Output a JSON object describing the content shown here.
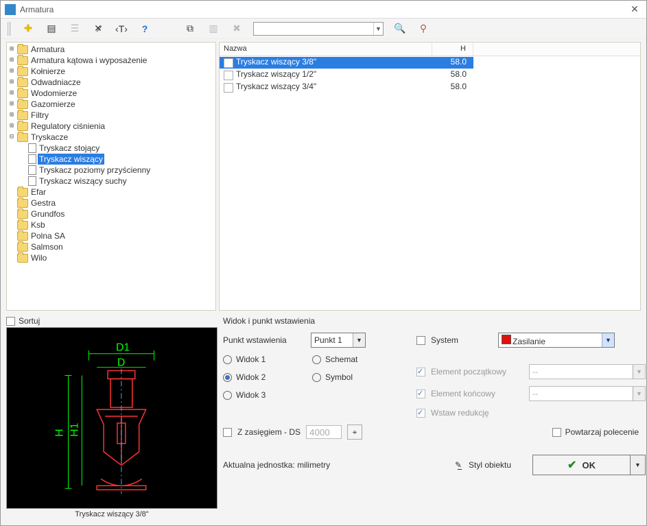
{
  "title": "Armatura",
  "toolbar": {
    "search_value": ""
  },
  "tree": [
    {
      "label": "Armatura",
      "type": "folder",
      "expandable": true
    },
    {
      "label": "Armatura kątowa i wyposażenie",
      "type": "folder",
      "expandable": true
    },
    {
      "label": "Kołnierze",
      "type": "folder",
      "expandable": true
    },
    {
      "label": "Odwadniacze",
      "type": "folder",
      "expandable": true
    },
    {
      "label": "Wodomierze",
      "type": "folder",
      "expandable": true
    },
    {
      "label": "Gazomierze",
      "type": "folder",
      "expandable": true
    },
    {
      "label": "Filtry",
      "type": "folder",
      "expandable": true
    },
    {
      "label": "Regulatory ciśnienia",
      "type": "folder",
      "expandable": true
    },
    {
      "label": "Tryskacze",
      "type": "folder",
      "expandable": true,
      "expanded": true,
      "children": [
        {
          "label": "Tryskacz stojący",
          "type": "doc"
        },
        {
          "label": "Tryskacz wiszący",
          "type": "doc",
          "selected": true
        },
        {
          "label": "Tryskacz poziomy przyścienny",
          "type": "doc"
        },
        {
          "label": "Tryskacz wiszący suchy",
          "type": "doc"
        }
      ]
    },
    {
      "label": "Efar",
      "type": "folder"
    },
    {
      "label": "Gestra",
      "type": "folder"
    },
    {
      "label": "Grundfos",
      "type": "folder"
    },
    {
      "label": "Ksb",
      "type": "folder"
    },
    {
      "label": "Polna SA",
      "type": "folder"
    },
    {
      "label": "Salmson",
      "type": "folder"
    },
    {
      "label": "Wilo",
      "type": "folder"
    }
  ],
  "list": {
    "col1": "Nazwa",
    "col2": "H",
    "rows": [
      {
        "name": "Tryskacz wiszący 3/8\"",
        "h": "58.0",
        "selected": true
      },
      {
        "name": "Tryskacz wiszący 1/2\"",
        "h": "58.0"
      },
      {
        "name": "Tryskacz wiszący 3/4\"",
        "h": "58.0"
      }
    ]
  },
  "sort_label": "Sortuj",
  "preview_caption": "Tryskacz wiszący 3/8\"",
  "preview_labels": {
    "D1": "D1",
    "D": "D",
    "H": "H",
    "H1": "H1"
  },
  "group_title": "Widok i punkt wstawienia",
  "point_label": "Punkt wstawienia",
  "point_value": "Punkt 1",
  "views": {
    "v1": "Widok 1",
    "v2": "Widok 2",
    "v3": "Widok 3",
    "schemat": "Schemat",
    "symbol": "Symbol",
    "selected": "v2"
  },
  "range_label": "Z zasięgiem - DS",
  "range_value": "4000",
  "system_label": "System",
  "zasilanie_label": "Zasilanie",
  "el_pocz": "Element początkowy",
  "el_kon": "Element końcowy",
  "wstaw_red": "Wstaw redukcję",
  "dash": "--",
  "repeat_label": "Powtarzaj polecenie",
  "unit_label": "Aktualna jednostka: milimetry",
  "styl_label": "Styl obiektu",
  "ok_label": "OK"
}
